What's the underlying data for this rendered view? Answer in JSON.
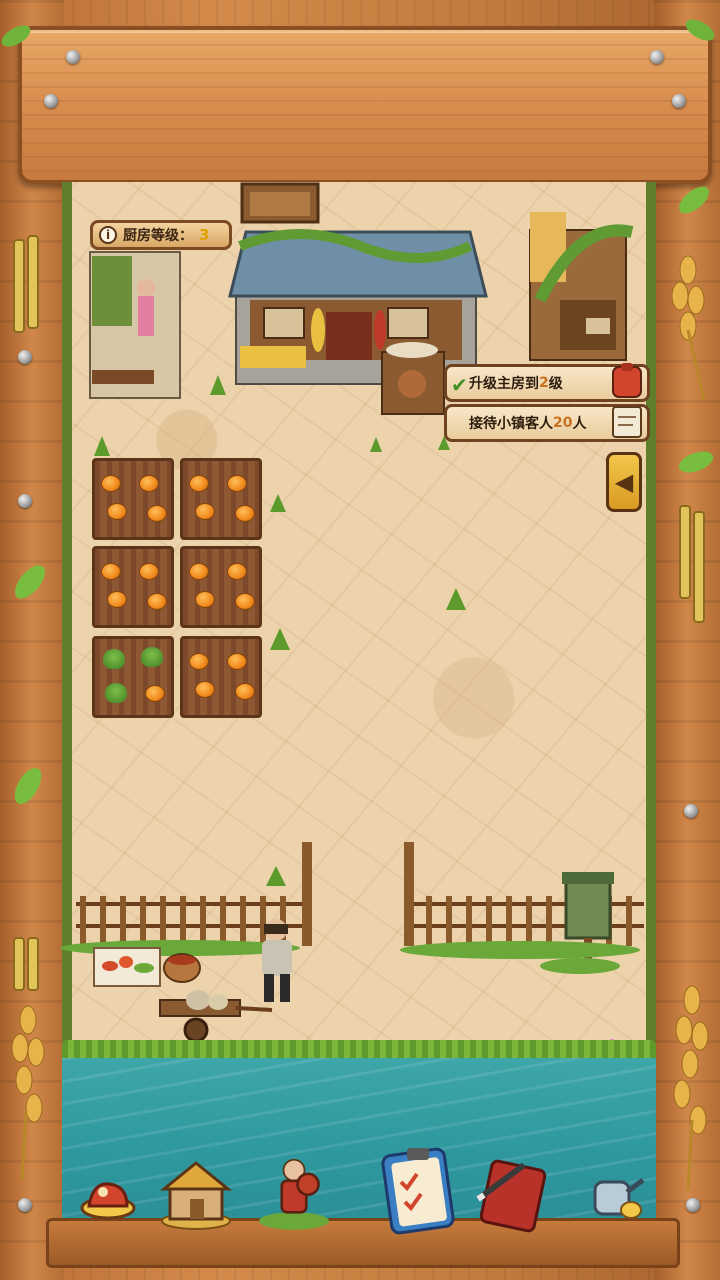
{
  "hud": {
    "level_label": "厨房等级：",
    "level_value": "3"
  },
  "quests": [
    {
      "text_prefix": "升级主房到",
      "num": "2",
      "text_suffix": "级",
      "status": "done"
    },
    {
      "text_prefix": "接待小镇客人",
      "num": "20",
      "text_suffix": "人",
      "status": "active"
    }
  ],
  "bottom_menu": [
    {
      "name": "cooking-menu-button",
      "icon": "food-plate-icon"
    },
    {
      "name": "house-menu-button",
      "icon": "house-icon"
    },
    {
      "name": "character-menu-button",
      "icon": "farmer-character-icon"
    },
    {
      "name": "task-menu-button",
      "icon": "clipboard-checklist-icon"
    },
    {
      "name": "recipe-book-button",
      "icon": "book-pen-icon"
    },
    {
      "name": "shop-menu-button",
      "icon": "watering-can-icon"
    }
  ],
  "colors": {
    "accent": "#e0a000",
    "wood": "#d08749",
    "water": "#2f9aa0",
    "check": "#3f8f23"
  }
}
